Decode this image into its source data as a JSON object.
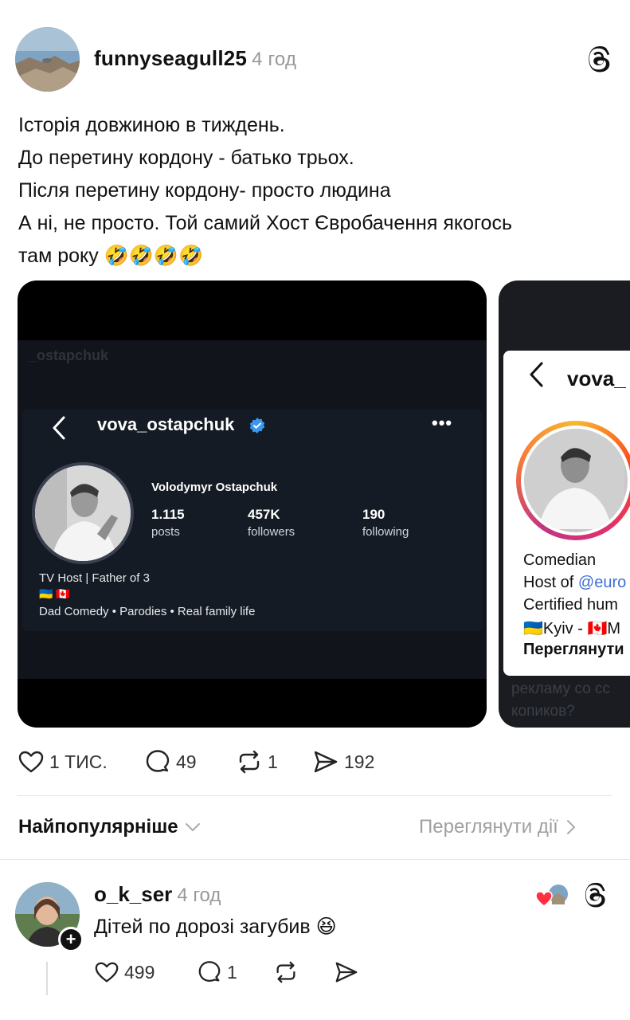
{
  "post": {
    "username": "funnyseagull25",
    "time": "4 год",
    "text_lines": [
      "Історія довжиною в тиждень.",
      "До перетину кордону - батько трьох.",
      "Після перетину кордону- просто людина",
      "А ні, не просто. Той самий Хост Євробачення якогось",
      "там року 🤣🤣🤣🤣"
    ]
  },
  "screenshot1": {
    "ghost_handle": "_ostapchuk",
    "handle": "vova_ostapchuk",
    "name": "Volodymyr Ostapchuk",
    "posts_value": "1.115",
    "posts_label": "posts",
    "followers_value": "457K",
    "followers_label": "followers",
    "following_value": "190",
    "following_label": "following",
    "bio_line1": "TV Host | Father of 3",
    "bio_flags": "🇺🇦 🇨🇦",
    "bio_line3": "Dad Comedy • Parodies • Real family life"
  },
  "screenshot2": {
    "handle": "vova_",
    "line1": "Comedian",
    "line2_prefix": "Host of ",
    "line2_link": "@euro",
    "line3": "Certified hum",
    "line4": "🇺🇦Kyiv - 🇨🇦M",
    "line5": "Переглянути",
    "ghost_bottom1": "рекламу со сс",
    "ghost_bottom2": "копиков?"
  },
  "actions": {
    "likes": "1 тис.",
    "comments": "49",
    "reposts": "1",
    "shares": "192"
  },
  "sort": {
    "label": "Найпопулярніше",
    "activity": "Переглянути дії"
  },
  "comment": {
    "username": "o_k_ser",
    "time": "4 год",
    "text": "Дітей по дорозі загубив 😆",
    "likes": "499",
    "replies": "1"
  },
  "colors": {
    "accent_verified": "#3897f0",
    "like_heart": "#ff3040",
    "muted": "#999999"
  }
}
